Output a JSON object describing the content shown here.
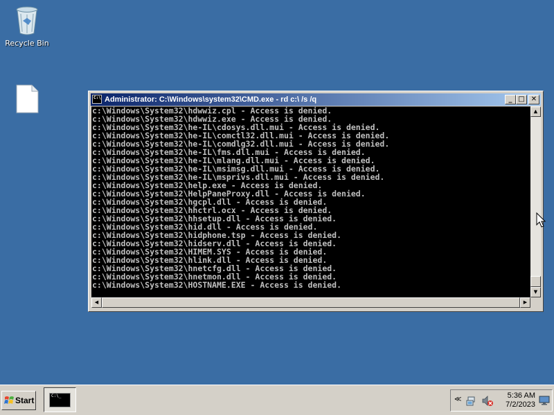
{
  "desktop": {
    "icons": [
      {
        "label": "Recycle Bin",
        "icon": "recycle-bin-icon"
      },
      {
        "label": "",
        "icon": "blank-file-icon"
      }
    ]
  },
  "window": {
    "title": "Administrator: C:\\Windows\\system32\\CMD.exe - rd  c:\\ /s /q",
    "buttons": {
      "minimize": "_",
      "maximize": "□",
      "close": "✕"
    },
    "console_lines": [
      "c:\\Windows\\System32\\hdwwiz.cpl - Access is denied.",
      "c:\\Windows\\System32\\hdwwiz.exe - Access is denied.",
      "c:\\Windows\\System32\\he-IL\\cdosys.dll.mui - Access is denied.",
      "c:\\Windows\\System32\\he-IL\\comctl32.dll.mui - Access is denied.",
      "c:\\Windows\\System32\\he-IL\\comdlg32.dll.mui - Access is denied.",
      "c:\\Windows\\System32\\he-IL\\fms.dll.mui - Access is denied.",
      "c:\\Windows\\System32\\he-IL\\mlang.dll.mui - Access is denied.",
      "c:\\Windows\\System32\\he-IL\\msimsg.dll.mui - Access is denied.",
      "c:\\Windows\\System32\\he-IL\\msprivs.dll.mui - Access is denied.",
      "c:\\Windows\\System32\\help.exe - Access is denied.",
      "c:\\Windows\\System32\\HelpPaneProxy.dll - Access is denied.",
      "c:\\Windows\\System32\\hgcpl.dll - Access is denied.",
      "c:\\Windows\\System32\\hhctrl.ocx - Access is denied.",
      "c:\\Windows\\System32\\hhsetup.dll - Access is denied.",
      "c:\\Windows\\System32\\hid.dll - Access is denied.",
      "c:\\Windows\\System32\\hidphone.tsp - Access is denied.",
      "c:\\Windows\\System32\\hidserv.dll - Access is denied.",
      "c:\\Windows\\System32\\HIMEM.SYS - Access is denied.",
      "c:\\Windows\\System32\\hlink.dll - Access is denied.",
      "c:\\Windows\\System32\\hnetcfg.dll - Access is denied.",
      "c:\\Windows\\System32\\hnetmon.dll - Access is denied.",
      "c:\\Windows\\System32\\HOSTNAME.EXE - Access is denied."
    ],
    "cmd_icon_text": "C:\\"
  },
  "taskbar": {
    "start_label": "Start",
    "task_thumb_text": "C:\\_",
    "clock_time": "5:36 AM",
    "clock_date": "7/2/2023",
    "tray_chevron": "≪"
  },
  "colors": {
    "desktop": "#3a6da4",
    "console_bg": "#000000",
    "console_fg": "#c0c0c0",
    "title_start": "#0a246a",
    "title_end": "#a6caf0",
    "chrome": "#d4d0c8"
  }
}
